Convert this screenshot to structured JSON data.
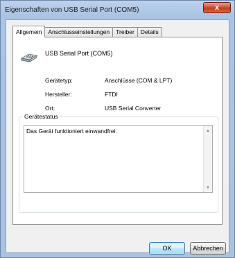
{
  "window": {
    "title": "Eigenschaften von USB Serial Port (COM5)",
    "close_glyph": "x"
  },
  "tabs": [
    {
      "label": "Allgemein",
      "active": true
    },
    {
      "label": "Anschlusseinstellungen",
      "active": false
    },
    {
      "label": "Treiber",
      "active": false
    },
    {
      "label": "Details",
      "active": false
    }
  ],
  "device": {
    "name": "USB Serial Port (COM5)",
    "icon": "serial-port-icon"
  },
  "properties": [
    {
      "label": "Gerätetyp:",
      "value": "Anschlüsse (COM & LPT)"
    },
    {
      "label": "Hersteller:",
      "value": "FTDI"
    },
    {
      "label": "Ort:",
      "value": "USB Serial Converter"
    }
  ],
  "status": {
    "group_title": "Gerätestatus",
    "text": "Das Gerät funktioniert einwandfrei.",
    "scroll_up_glyph": "▲",
    "scroll_down_glyph": "▼"
  },
  "buttons": {
    "ok_label": "OK",
    "cancel_label": "Abbrechen"
  },
  "colors": {
    "title_bar": "#aac3e1",
    "close_button": "#c5391d",
    "default_button_border": "#3c7fb1"
  }
}
